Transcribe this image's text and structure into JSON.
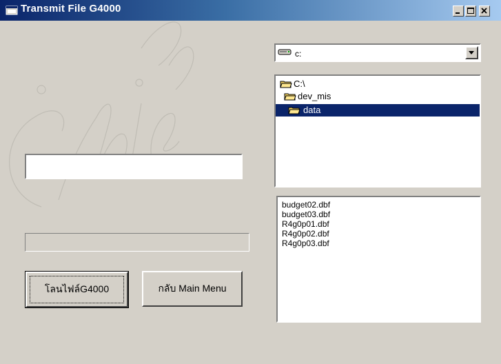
{
  "window": {
    "title": "Transmit File G4000",
    "controls": {
      "minimize": "minimize-icon",
      "maximize": "maximize-icon",
      "close": "close-icon"
    }
  },
  "drive": {
    "value": "c:"
  },
  "directories": [
    {
      "label": "C:\\",
      "selected": false
    },
    {
      "label": "dev_mis",
      "selected": false
    },
    {
      "label": "data",
      "selected": true
    }
  ],
  "files": [
    "budget02.dbf",
    "budget03.dbf",
    "R4g0p01.dbf",
    "R4g0p02.dbf",
    "R4g0p03.dbf"
  ],
  "textbox": {
    "value": ""
  },
  "progress": {
    "value": 0
  },
  "buttons": {
    "load": "โลนไฟล์G4000",
    "back": "กลับ Main Menu"
  },
  "watermark": "Chiang",
  "colors": {
    "selection": "#0a246a",
    "titlebar": "#0a246a",
    "face": "#d4d0c8",
    "folder": "#f0d060"
  }
}
